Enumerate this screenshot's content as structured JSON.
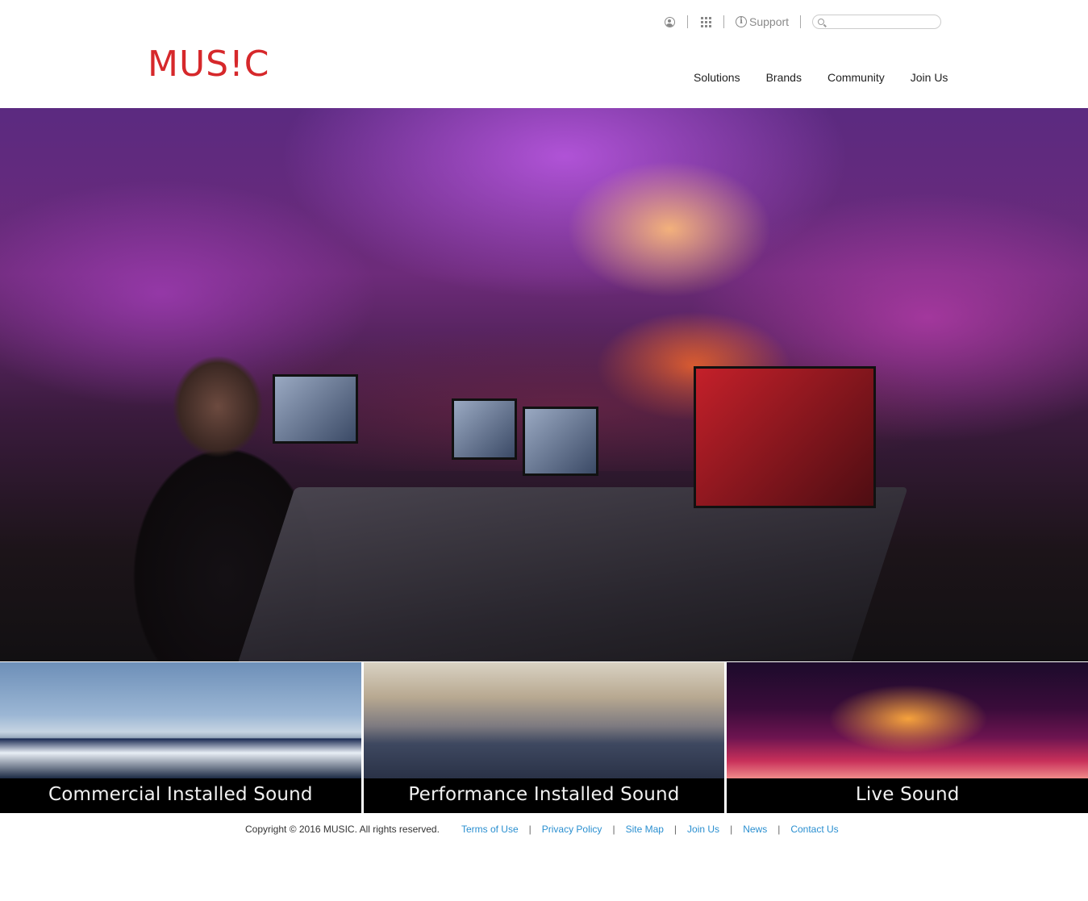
{
  "utility": {
    "support_label": "Support",
    "search_placeholder": ""
  },
  "logo": {
    "text": "MUS!C"
  },
  "nav": {
    "items": [
      "Solutions",
      "Brands",
      "Community",
      "Join Us"
    ]
  },
  "tiles": [
    {
      "label": "Commercial Installed Sound"
    },
    {
      "label": "Performance Installed Sound"
    },
    {
      "label": "Live Sound"
    }
  ],
  "footer": {
    "copyright": "Copyright © 2016 MUSIC. All rights reserved.",
    "links": [
      "Terms of Use",
      "Privacy Policy",
      "Site Map",
      "Join Us",
      "News",
      "Contact Us"
    ]
  },
  "colors": {
    "brand": "#d6282b",
    "link": "#2a8fd0"
  },
  "icons": [
    "user-icon",
    "apps-grid-icon",
    "info-icon",
    "search-icon"
  ]
}
